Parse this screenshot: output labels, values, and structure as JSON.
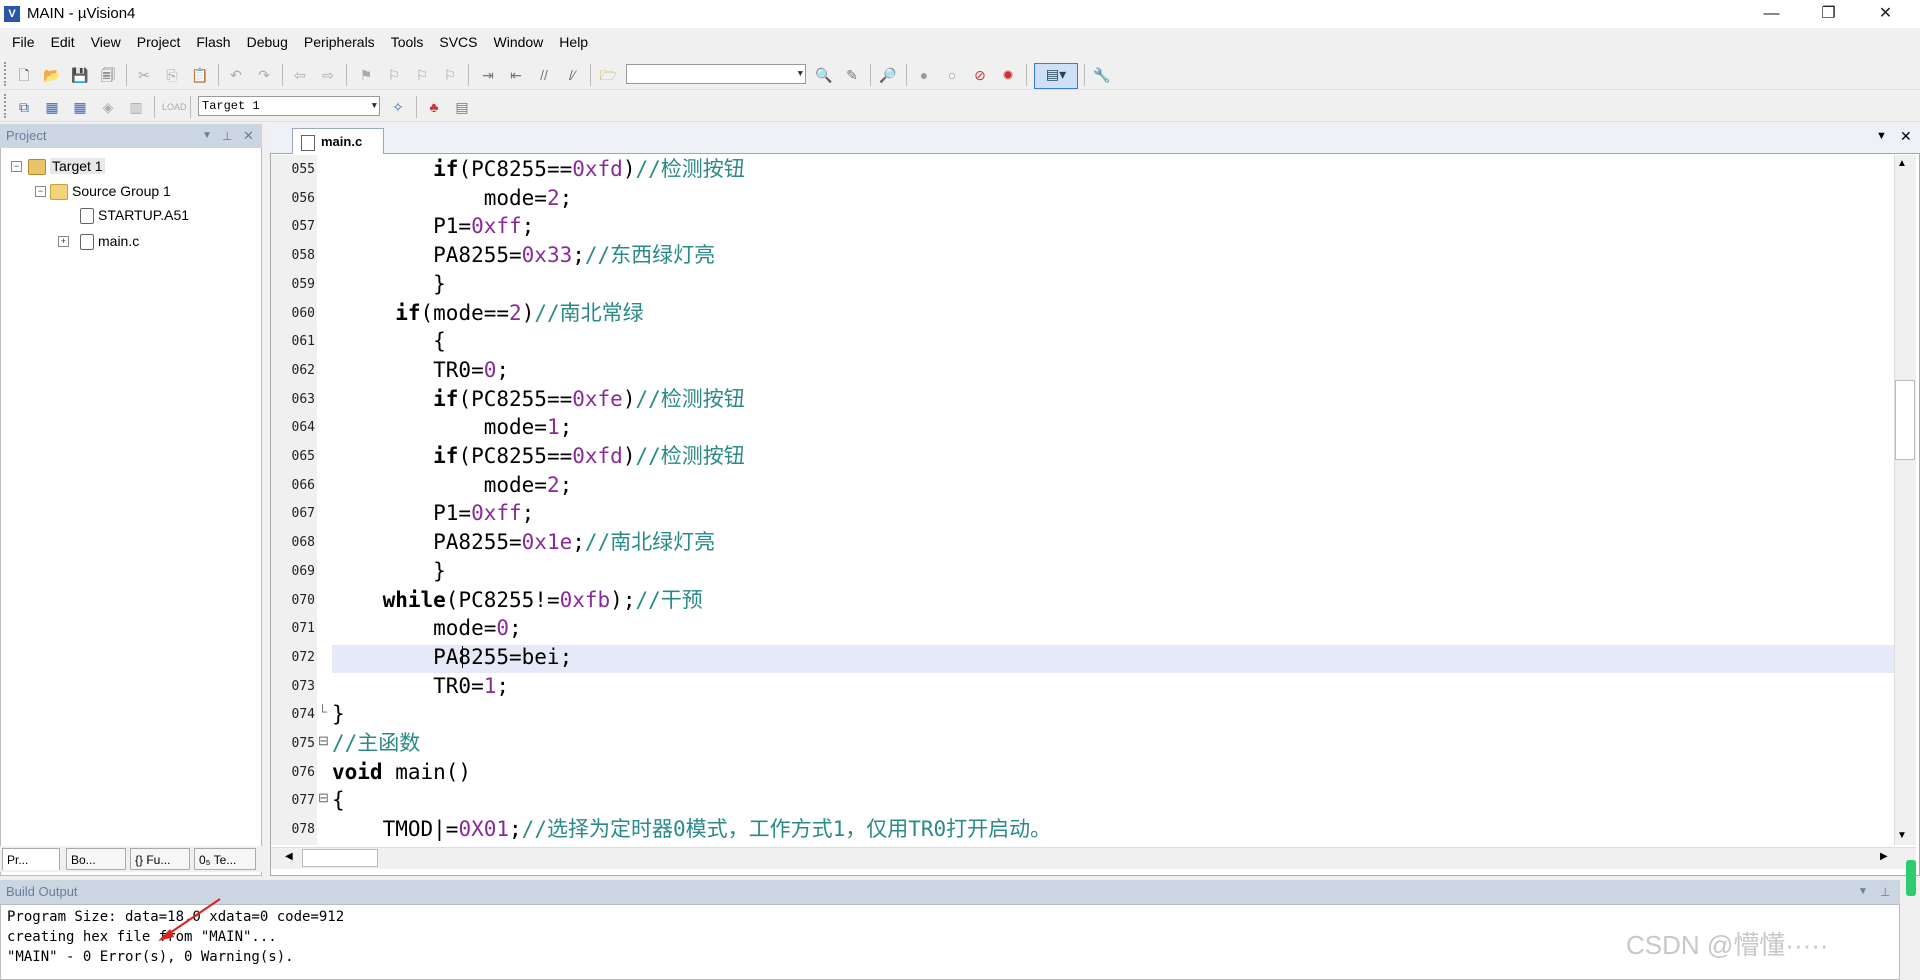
{
  "window": {
    "title": "MAIN - µVision4",
    "app_icon": "uv-icon",
    "minimize": "—",
    "restore": "❐",
    "close": "✕"
  },
  "menu": {
    "items": [
      "File",
      "Edit",
      "View",
      "Project",
      "Flash",
      "Debug",
      "Peripherals",
      "Tools",
      "SVCS",
      "Window",
      "Help"
    ]
  },
  "toolbar2": {
    "target_combo": "Target 1"
  },
  "project_panel": {
    "title": "Project",
    "tree": {
      "root": "Target 1",
      "group": "Source Group 1",
      "files": [
        "STARTUP.A51",
        "main.c"
      ]
    },
    "tabs": [
      "Pr...",
      "Bo...",
      "{} Fu...",
      "0₅ Te..."
    ]
  },
  "editor": {
    "active_tab": "main.c",
    "current_line": "072",
    "lines": [
      {
        "n": "055",
        "text": "        if(PC8255==0xfd)//检测按钮"
      },
      {
        "n": "056",
        "text": "            mode=2;"
      },
      {
        "n": "057",
        "text": "        P1=0xff;"
      },
      {
        "n": "058",
        "text": "        PA8255=0x33;//东西绿灯亮"
      },
      {
        "n": "059",
        "text": "        }"
      },
      {
        "n": "060",
        "text": "     if(mode==2)//南北常绿"
      },
      {
        "n": "061",
        "text": "        {"
      },
      {
        "n": "062",
        "text": "        TR0=0;"
      },
      {
        "n": "063",
        "text": "        if(PC8255==0xfe)//检测按钮"
      },
      {
        "n": "064",
        "text": "            mode=1;"
      },
      {
        "n": "065",
        "text": "        if(PC8255==0xfd)//检测按钮"
      },
      {
        "n": "066",
        "text": "            mode=2;"
      },
      {
        "n": "067",
        "text": "        P1=0xff;"
      },
      {
        "n": "068",
        "text": "        PA8255=0x1e;//南北绿灯亮"
      },
      {
        "n": "069",
        "text": "        }"
      },
      {
        "n": "070",
        "text": "    while(PC8255!=0xfb);//干预"
      },
      {
        "n": "071",
        "text": "        mode=0;"
      },
      {
        "n": "072",
        "text": "        PA8255=bei;"
      },
      {
        "n": "073",
        "text": "        TR0=1;"
      },
      {
        "n": "074",
        "text": "}"
      },
      {
        "n": "075",
        "text": "//主函数"
      },
      {
        "n": "076",
        "text": "void main()"
      },
      {
        "n": "077",
        "text": "{"
      },
      {
        "n": "078",
        "text": "    TMOD|=0X01;//选择为定时器0模式，工作方式1，仅用TR0打开启动。"
      }
    ]
  },
  "build_output": {
    "title": "Build Output",
    "lines": [
      "Program Size: data=18.0 xdata=0 code=912",
      "creating hex file from \"MAIN\"...",
      "\"MAIN\" - 0 Error(s), 0 Warning(s)."
    ]
  },
  "watermark": "CSDN @懵懂·····",
  "colors": {
    "panel_header": "#ccd6e3",
    "current_line": "#e6e9f7",
    "comment": "#2a8a88",
    "number": "#8a2a9a"
  }
}
